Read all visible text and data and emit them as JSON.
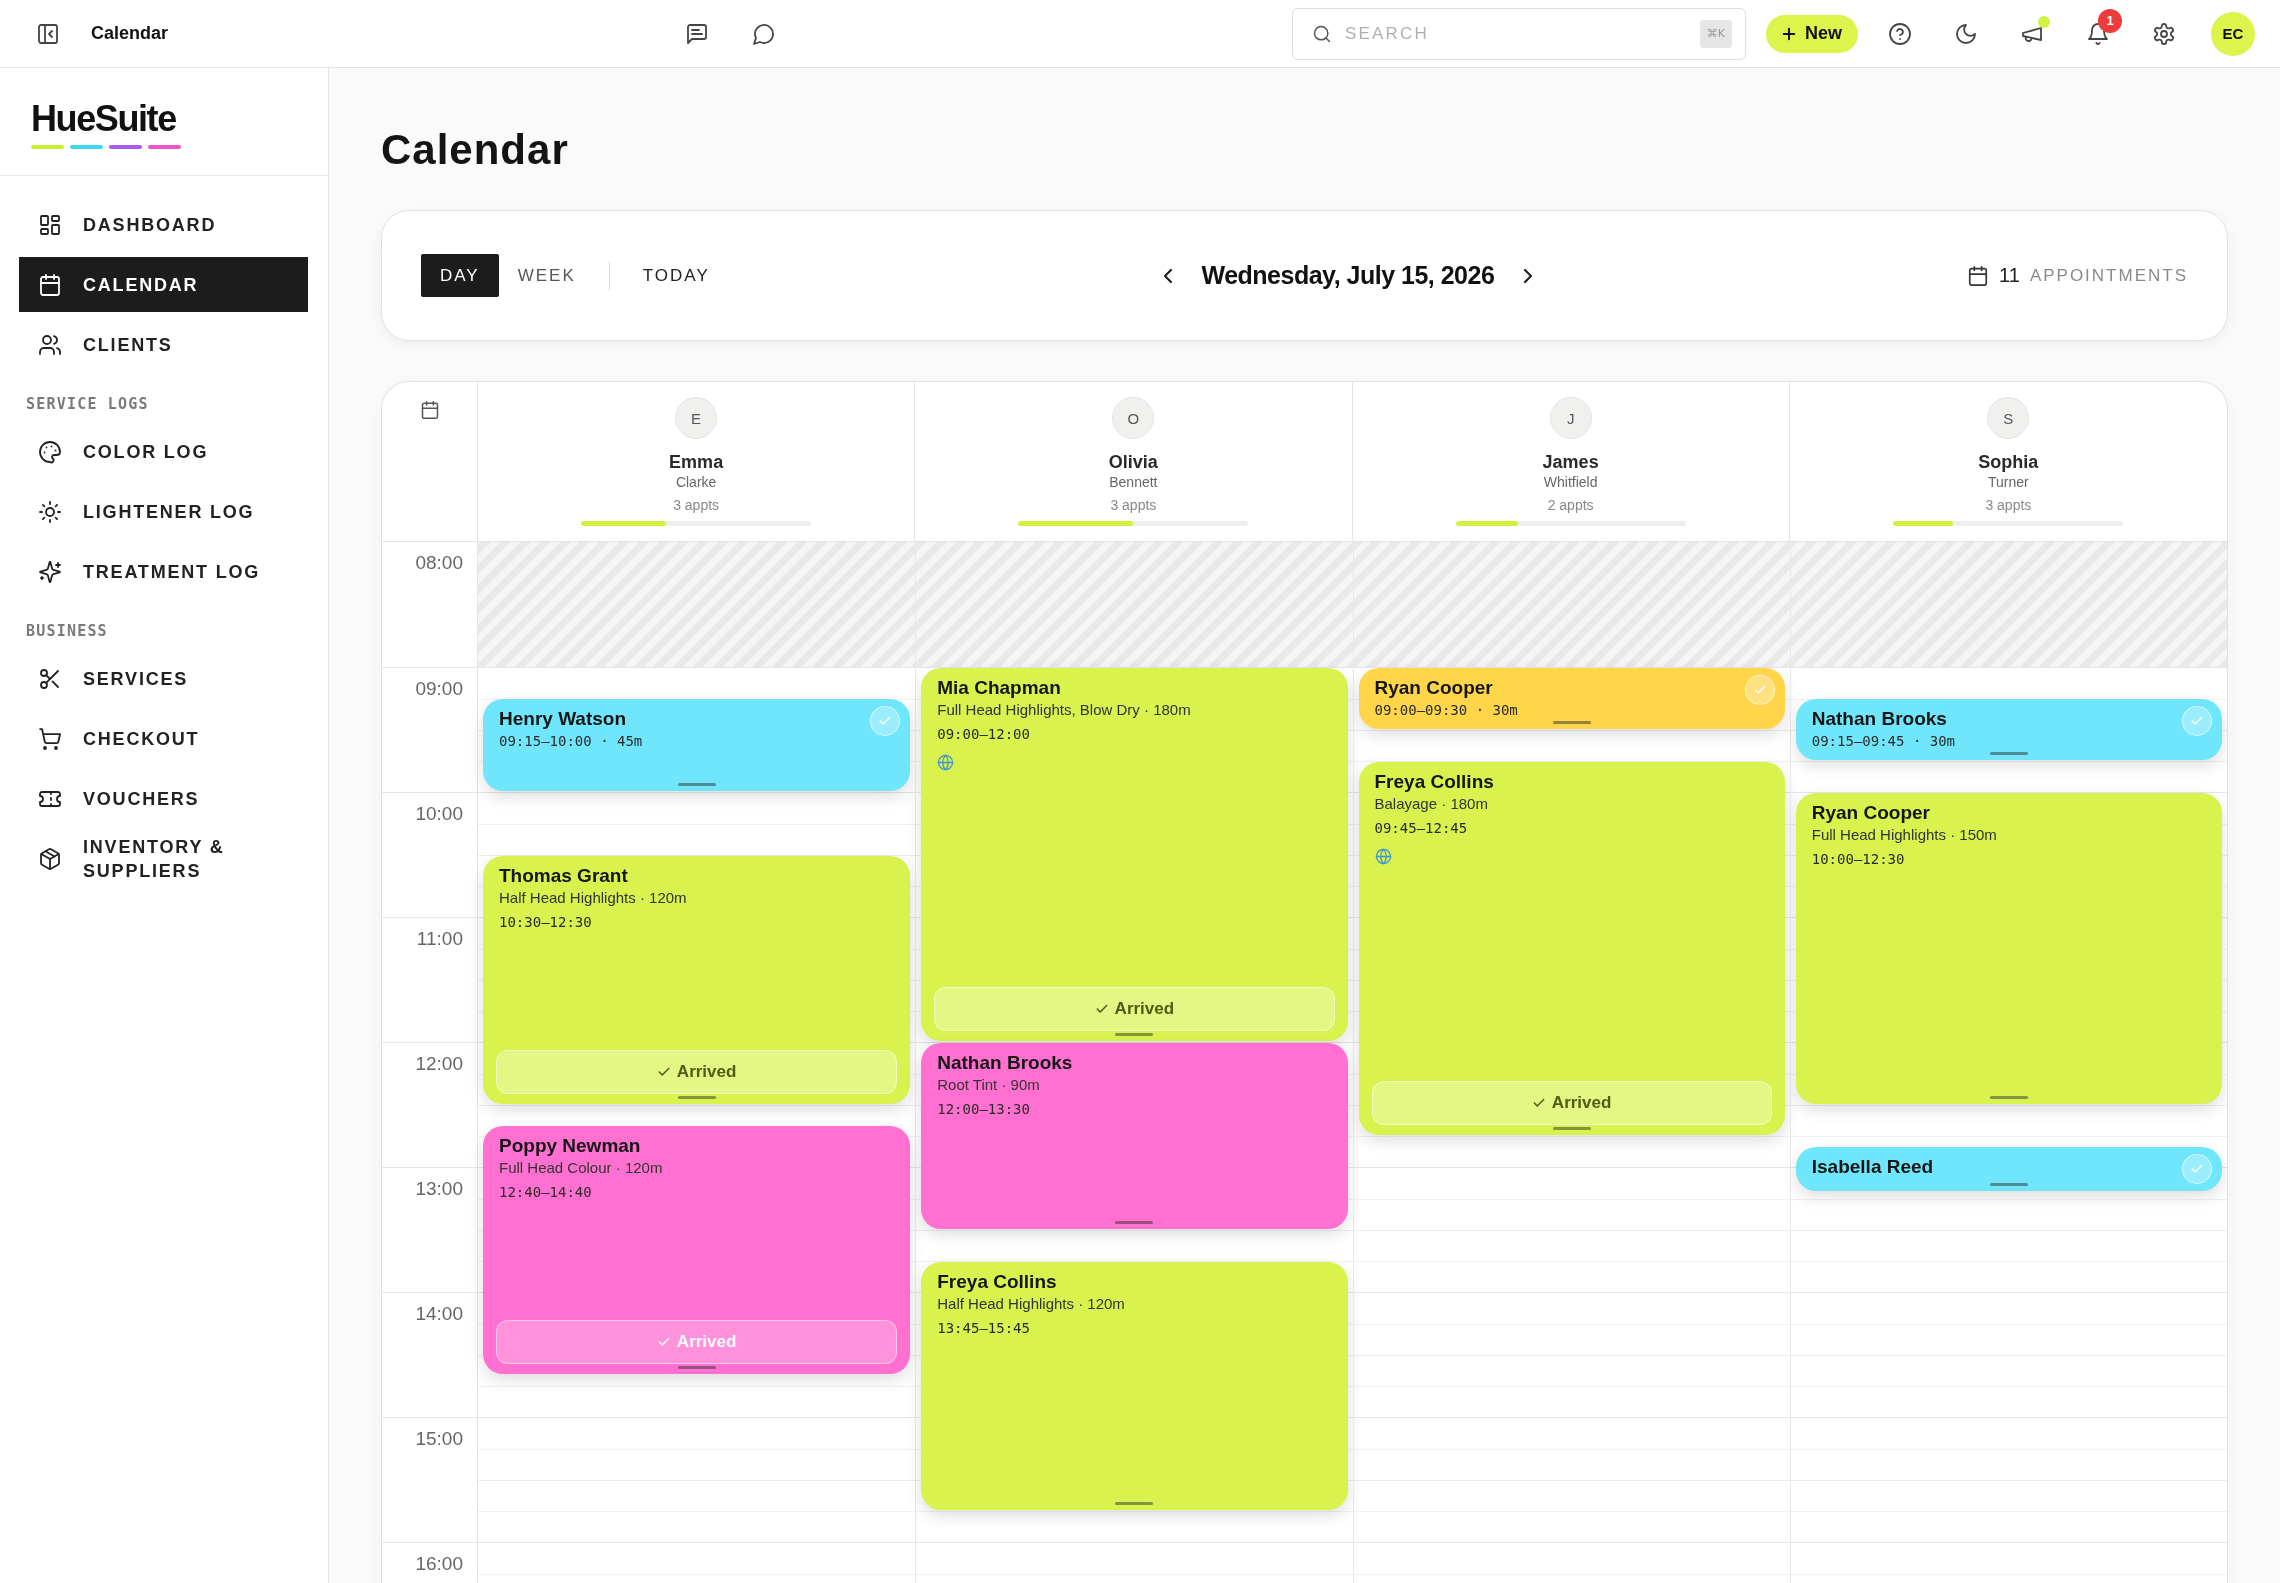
{
  "topbar": {
    "title": "Calendar",
    "search": {
      "placeholder": "SEARCH",
      "shortcut": "⌘K"
    },
    "new_button": "New",
    "announcements_unread": true,
    "notifications_badge": "1",
    "avatar_initials": "EC"
  },
  "sidebar": {
    "logo": "HueSuite",
    "sections": [
      {
        "items": [
          {
            "label": "DASHBOARD",
            "selected": false
          },
          {
            "label": "CALENDAR",
            "selected": true
          },
          {
            "label": "CLIENTS",
            "selected": false
          }
        ]
      },
      {
        "heading": "SERVICE LOGS",
        "items": [
          {
            "label": "COLOR LOG",
            "selected": false
          },
          {
            "label": "LIGHTENER LOG",
            "selected": false
          },
          {
            "label": "TREATMENT LOG",
            "selected": false
          }
        ]
      },
      {
        "heading": "BUSINESS",
        "items": [
          {
            "label": "SERVICES",
            "selected": false
          },
          {
            "label": "CHECKOUT",
            "selected": false
          },
          {
            "label": "VOUCHERS",
            "selected": false
          },
          {
            "label": "INVENTORY & SUPPLIERS",
            "selected": false
          }
        ]
      }
    ]
  },
  "page_title": "Calendar",
  "toolbar": {
    "tabs": [
      {
        "label": "DAY",
        "selected": true
      },
      {
        "label": "WEEK",
        "selected": false
      }
    ],
    "today_button": "TODAY",
    "date": "Wednesday, July 15, 2026",
    "appointment_count": "11",
    "appointment_label": "APPOINTMENTS"
  },
  "calendar": {
    "hours": [
      {
        "label": "08:00",
        "closed": true
      },
      {
        "label": "09:00",
        "closed": false
      },
      {
        "label": "10:00",
        "closed": false
      },
      {
        "label": "11:00",
        "closed": false
      },
      {
        "label": "12:00",
        "closed": false
      },
      {
        "label": "13:00",
        "closed": false
      },
      {
        "label": "14:00",
        "closed": false
      },
      {
        "label": "15:00",
        "closed": false
      },
      {
        "label": "16:00",
        "closed": false
      }
    ],
    "staff": [
      {
        "initial": "E",
        "first_name": "Emma",
        "last_name": "Clarke",
        "count": "3 appts",
        "level": 0.37,
        "events": [
          {
            "kind": "compact",
            "client": "Henry Watson",
            "time": "09:15–10:00 · 45m",
            "color": "#6fe6fb",
            "online_booking": false
          },
          {
            "kind": "full",
            "client": "Thomas Grant",
            "service": "Half Head Highlights · 120m",
            "time": "10:30–12:30",
            "color": "#d9f24e",
            "online_booking": false,
            "status_button": "Arrived"
          },
          {
            "kind": "full",
            "client": "Poppy Newman",
            "service": "Full Head Colour · 120m",
            "time": "12:40–14:40",
            "color": "#ff70d0",
            "online_booking": false,
            "status_button": "Arrived"
          }
        ]
      },
      {
        "initial": "O",
        "first_name": "Olivia",
        "last_name": "Bennett",
        "count": "3 appts",
        "level": 0.5,
        "events": [
          {
            "kind": "full",
            "client": "Mia Chapman",
            "service": "Full Head Highlights, Blow Dry · 180m",
            "time": "09:00–12:00",
            "color": "#d9f24e",
            "online_booking": true,
            "status_button": "Arrived"
          },
          {
            "kind": "full",
            "client": "Nathan Brooks",
            "service": "Root Tint · 90m",
            "time": "12:00–13:30",
            "color": "#ff70d0",
            "online_booking": false
          },
          {
            "kind": "full",
            "client": "Freya Collins",
            "service": "Half Head Highlights · 120m",
            "time": "13:45–15:45",
            "color": "#d9f24e",
            "online_booking": false
          }
        ]
      },
      {
        "initial": "J",
        "first_name": "James",
        "last_name": "Whitfield",
        "count": "2 appts",
        "level": 0.27,
        "events": [
          {
            "kind": "compact",
            "client": "Ryan Cooper",
            "time": "09:00–09:30 · 30m",
            "color": "#ffd54a",
            "online_booking": false
          },
          {
            "kind": "full",
            "client": "Freya Collins",
            "service": "Balayage · 180m",
            "time": "09:45–12:45",
            "color": "#d9f24e",
            "online_booking": true,
            "status_button": "Arrived"
          }
        ]
      },
      {
        "initial": "S",
        "first_name": "Sophia",
        "last_name": "Turner",
        "count": "3 appts",
        "level": 0.26,
        "events": [
          {
            "kind": "compact",
            "client": "Nathan Brooks",
            "time": "09:15–09:45 · 30m",
            "color": "#6fe6fb",
            "online_booking": false
          },
          {
            "kind": "full",
            "client": "Ryan Cooper",
            "service": "Full Head Highlights · 150m",
            "time": "10:00–12:30",
            "color": "#d9f24e",
            "online_booking": false
          },
          {
            "kind": "compact",
            "client": "Isabella Reed",
            "color": "#6fe6fb",
            "online_booking": false
          }
        ]
      }
    ]
  }
}
